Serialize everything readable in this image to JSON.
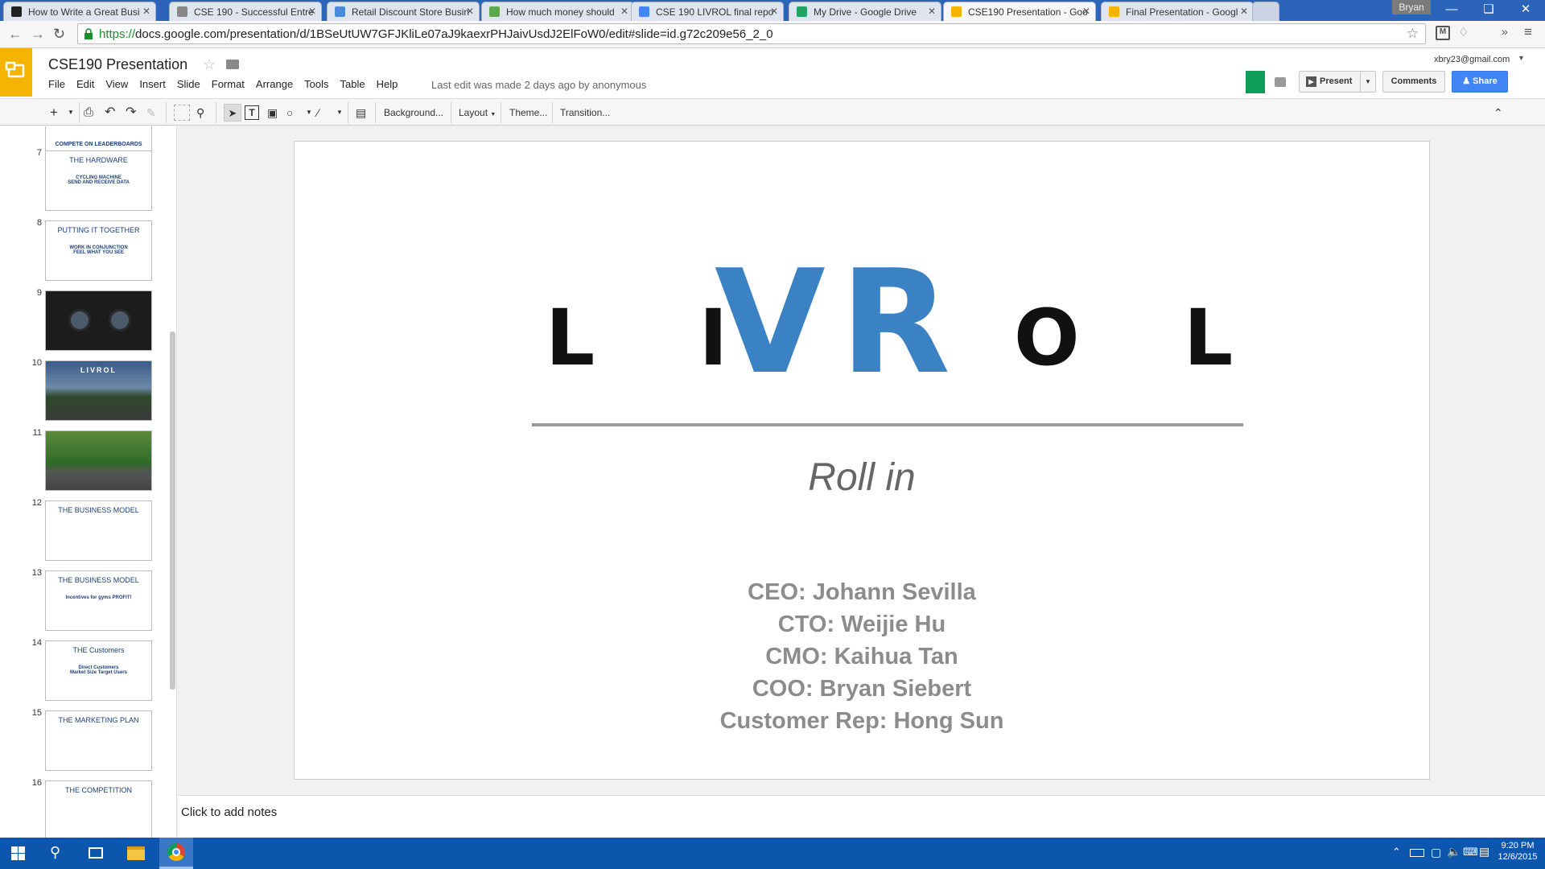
{
  "browser": {
    "tabs": [
      {
        "title": "How to Write a Great Busi",
        "fav_color": "#222222"
      },
      {
        "title": "CSE 190 - Successful Entre",
        "fav_color": "#888888"
      },
      {
        "title": "Retail Discount Store Busin",
        "fav_color": "#4a8ad8"
      },
      {
        "title": "How much money should",
        "fav_color": "#5ea84f"
      },
      {
        "title": "CSE 190 LIVROL final repo",
        "fav_color": "#4285f4"
      },
      {
        "title": "My Drive - Google Drive",
        "fav_color": "#1fa463"
      },
      {
        "title": "CSE190 Presentation - Goo",
        "fav_color": "#f4b400",
        "active": true
      },
      {
        "title": "Final Presentation - Googl",
        "fav_color": "#f4b400"
      }
    ],
    "user_chip": "Bryan",
    "url_scheme": "https://",
    "url_rest": "docs.google.com/presentation/d/1BSeUtUW7GFJKliLe07aJ9kaexrPHJaivUsdJ2ElFoW0/edit#slide=id.g72c209e56_2_0"
  },
  "app": {
    "title": "CSE190 Presentation",
    "menu": [
      "File",
      "Edit",
      "View",
      "Insert",
      "Slide",
      "Format",
      "Arrange",
      "Tools",
      "Table",
      "Help"
    ],
    "last_edit": "Last edit was made 2 days ago by anonymous",
    "account": "xbry23@gmail.com",
    "present_label": "Present",
    "comments_label": "Comments",
    "share_label": "Share",
    "brand_color": "#f4b400",
    "share_color": "#4285f4"
  },
  "toolbar": {
    "background": "Background...",
    "layout": "Layout",
    "theme": "Theme...",
    "transition": "Transition..."
  },
  "filmstrip": {
    "top_partial_caption": "COMPETE ON LEADERBOARDS",
    "slides": [
      {
        "num": "7",
        "title": "THE HARDWARE",
        "caption": "CYCLING MACHINE\nSEND AND RECEIVE DATA"
      },
      {
        "num": "8",
        "title": "PUTTING IT TOGETHER",
        "caption": "WORK IN CONJUNCTION\nFEEL WHAT YOU SEE"
      },
      {
        "num": "9",
        "title": "",
        "caption": ""
      },
      {
        "num": "10",
        "title": "LIVROL",
        "caption": ""
      },
      {
        "num": "11",
        "title": "",
        "caption": ""
      },
      {
        "num": "12",
        "title": "THE BUSINESS MODEL",
        "caption": ""
      },
      {
        "num": "13",
        "title": "THE BUSINESS MODEL",
        "caption": "Incentives for gyms   PROFIT!"
      },
      {
        "num": "14",
        "title": "THE Customers",
        "caption": "Direct Customers\nMarket Size   Target Users"
      },
      {
        "num": "15",
        "title": "THE MARKETING PLAN",
        "caption": ""
      },
      {
        "num": "16",
        "title": "THE COMPETITION",
        "caption": ""
      }
    ]
  },
  "slide": {
    "logo_left": "L I ",
    "logo_v": "V",
    "logo_r": "R",
    "logo_right": "O L",
    "logo_blue": "#3a82c4",
    "tagline": "Roll in",
    "team": [
      "CEO: Johann Sevilla",
      "CTO: Weijie Hu",
      "CMO: Kaihua Tan",
      "COO: Bryan Siebert",
      "Customer Rep: Hong Sun"
    ]
  },
  "notes": {
    "placeholder": "Click to add notes"
  },
  "taskbar": {
    "time": "9:20 PM",
    "date": "12/6/2015"
  }
}
